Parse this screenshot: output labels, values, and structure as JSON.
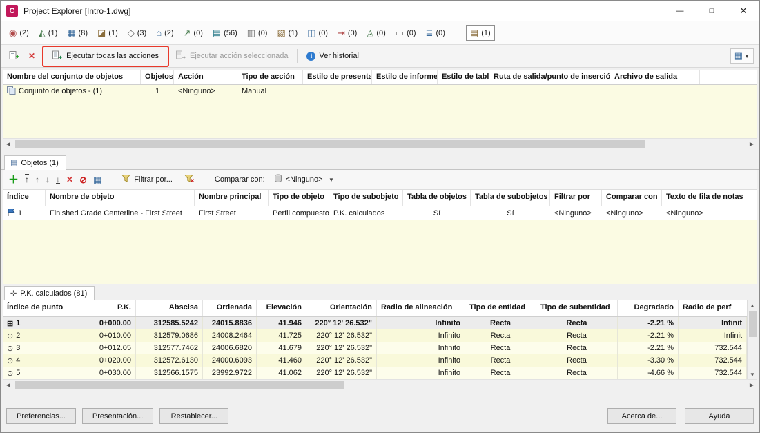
{
  "window": {
    "app_initial": "C",
    "title": "Project Explorer [Intro-1.dwg]"
  },
  "tabs": [
    {
      "name": "points",
      "glyph": "◉",
      "count": "(2)"
    },
    {
      "name": "surfaces",
      "glyph": "◭",
      "count": "(1)"
    },
    {
      "name": "point-groups",
      "glyph": "▦",
      "count": "(8)"
    },
    {
      "name": "drawing-styles",
      "glyph": "◪",
      "count": "(1)"
    },
    {
      "name": "parcels",
      "glyph": "◇",
      "count": "(3)"
    },
    {
      "name": "sites",
      "glyph": "⌂",
      "count": "(2)"
    },
    {
      "name": "feature-lines",
      "glyph": "↗",
      "count": "(0)"
    },
    {
      "name": "alignments",
      "glyph": "▤",
      "count": "(56)"
    },
    {
      "name": "sample-lines",
      "glyph": "▥",
      "count": "(0)"
    },
    {
      "name": "corridors",
      "glyph": "▧",
      "count": "(1)"
    },
    {
      "name": "assemblies",
      "glyph": "◫",
      "count": "(0)"
    },
    {
      "name": "intersections",
      "glyph": "⇥",
      "count": "(0)"
    },
    {
      "name": "pipe-networks",
      "glyph": "◬",
      "count": "(0)"
    },
    {
      "name": "pressure-networks",
      "glyph": "▭",
      "count": "(0)"
    },
    {
      "name": "tables",
      "glyph": "≣",
      "count": "(0)"
    },
    {
      "name": "action-sets",
      "glyph": "▤",
      "count": "(1)"
    }
  ],
  "toolbar": {
    "run_all_label": "Ejecutar todas las acciones",
    "run_selected_label": "Ejecutar acción seleccionada",
    "history_label": "Ver historial"
  },
  "actions_table": {
    "columns": [
      "Nombre del conjunto de objetos",
      "Objetos",
      "Acción",
      "Tipo de acción",
      "Estilo de presentación",
      "Estilo de informe",
      "Estilo de tabla",
      "Ruta de salida/punto de inserción",
      "Archivo de salida"
    ],
    "row": {
      "name": "Conjunto de objetos - (1)",
      "objects": "1",
      "action": "<Ninguno>",
      "action_type": "Manual"
    }
  },
  "objects": {
    "tab_label": "Objetos (1)",
    "filter_label": "Filtrar por...",
    "compare_label": "Comparar con:",
    "compare_value": "<Ninguno>",
    "columns": [
      "Índice",
      "Nombre de objeto",
      "Nombre principal",
      "Tipo de objeto",
      "Tipo de subobjeto",
      "Tabla de objetos",
      "Tabla de subobjetos",
      "Filtrar por",
      "Comparar con",
      "Texto de fila de notas"
    ],
    "row": {
      "index": "1",
      "name": "Finished Grade Centerline - First Street",
      "principal": "First Street",
      "type": "Perfil compuesto",
      "subtype": "P.K. calculados",
      "object_table": "Sí",
      "subobject_table": "Sí",
      "filter": "<Ninguno>",
      "compare": "<Ninguno>",
      "notes": "<Ninguno>"
    }
  },
  "stations": {
    "tab_label": "P.K. calculados (81)",
    "columns": [
      "Índice de punto",
      "P.K.",
      "Abscisa",
      "Ordenada",
      "Elevación",
      "Orientación",
      "Radio de alineación",
      "Tipo de entidad",
      "Tipo de subentidad",
      "Degradado",
      "Radio de perf"
    ],
    "rows": [
      {
        "glyph": "⊞",
        "index": "1",
        "pk": "0+000.00",
        "x": "312585.5242",
        "y": "24015.8836",
        "elev": "41.946",
        "bearing": "220° 12' 26.532\"",
        "radius": "Infinito",
        "entity": "Recta",
        "subentity": "Recta",
        "grade": "-2.21 %",
        "profile_radius": "Infinit"
      },
      {
        "glyph": "⊙",
        "index": "2",
        "pk": "0+010.00",
        "x": "312579.0686",
        "y": "24008.2464",
        "elev": "41.725",
        "bearing": "220° 12' 26.532\"",
        "radius": "Infinito",
        "entity": "Recta",
        "subentity": "Recta",
        "grade": "-2.21 %",
        "profile_radius": "Infinit"
      },
      {
        "glyph": "⊙",
        "index": "3",
        "pk": "0+012.05",
        "x": "312577.7462",
        "y": "24006.6820",
        "elev": "41.679",
        "bearing": "220° 12' 26.532\"",
        "radius": "Infinito",
        "entity": "Recta",
        "subentity": "Recta",
        "grade": "-2.21 %",
        "profile_radius": "732.544"
      },
      {
        "glyph": "⊙",
        "index": "4",
        "pk": "0+020.00",
        "x": "312572.6130",
        "y": "24000.6093",
        "elev": "41.460",
        "bearing": "220° 12' 26.532\"",
        "radius": "Infinito",
        "entity": "Recta",
        "subentity": "Recta",
        "grade": "-3.30 %",
        "profile_radius": "732.544"
      },
      {
        "glyph": "⊙",
        "index": "5",
        "pk": "0+030.00",
        "x": "312566.1575",
        "y": "23992.9722",
        "elev": "41.062",
        "bearing": "220° 12' 26.532\"",
        "radius": "Infinito",
        "entity": "Recta",
        "subentity": "Recta",
        "grade": "-4.66 %",
        "profile_radius": "732.544"
      }
    ]
  },
  "footer": {
    "preferences": "Preferencias...",
    "presentation": "Presentación...",
    "reset": "Restablecer...",
    "about": "Acerca de...",
    "help": "Ayuda"
  }
}
